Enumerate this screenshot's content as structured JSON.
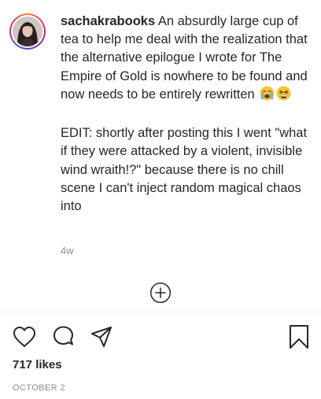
{
  "post": {
    "username": "sachakrabooks",
    "caption": " An absurdly large cup of tea to help me deal with the realization that the alternative epilogue I wrote for The Empire of Gold is nowhere to be found and now needs to be entirely rewritten",
    "edit_text": "EDIT: shortly after posting this I went \"what if they were attacked by a violent, invisible wind wraith!?\" because there is no chill scene I can't inject random magical chaos into",
    "time_ago": "4w",
    "likes": "717 likes",
    "date": "OCTOBER 2"
  },
  "emojis": [
    "loudly-crying-face-emoji",
    "tired-face-emoji"
  ],
  "icons": {
    "avatar": "profile-photo",
    "load_more": "plus-circle-icon",
    "like": "heart-icon",
    "comment": "speech-bubble-icon",
    "share": "paper-plane-icon",
    "save": "bookmark-icon"
  },
  "colors": {
    "text": "#262626",
    "secondary": "#8e8e8e",
    "divider": "#efefef",
    "ring_start": "#f58529",
    "ring_mid": "#dd2a7b",
    "ring_end": "#8134af"
  }
}
